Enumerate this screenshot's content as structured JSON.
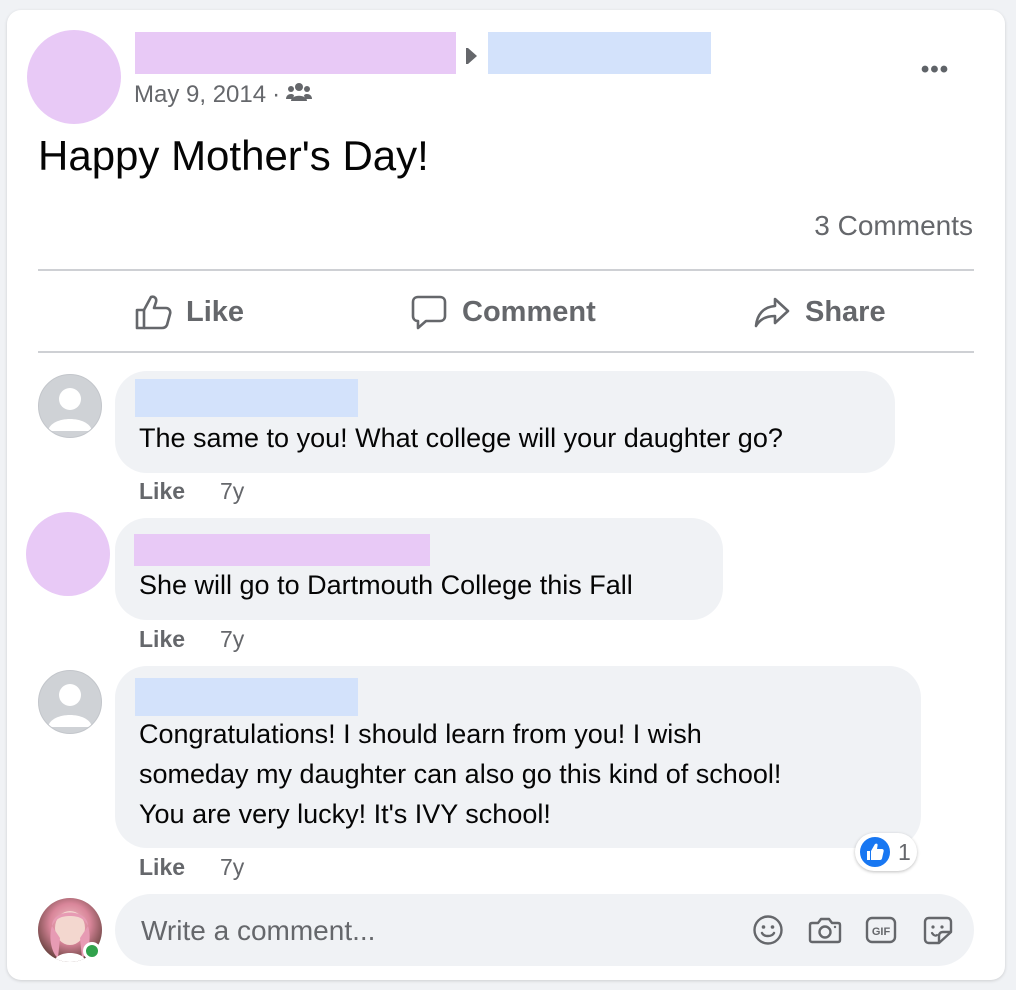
{
  "post": {
    "date": "May 9, 2014",
    "separator": "·",
    "audience_icon": "friends-icon",
    "more_icon": "more-options-icon",
    "more_label": "•••",
    "text": "Happy Mother's Day!",
    "comments_count": "3 Comments"
  },
  "actions": {
    "like": "Like",
    "comment": "Comment",
    "share": "Share"
  },
  "comments": [
    {
      "text": "The same to you! What college will your daughter go?",
      "like": "Like",
      "time": "7y"
    },
    {
      "text": "She will go to Dartmouth College this Fall",
      "like": "Like",
      "time": "7y"
    },
    {
      "lines": [
        "Congratulations! I should learn from you! I wish",
        "someday my daughter can also go this kind of school!",
        "You are very lucky! It's IVY school!"
      ],
      "like": "Like",
      "time": "7y",
      "reaction_count": "1"
    }
  ],
  "composer": {
    "placeholder": "Write a comment...",
    "tools": [
      "emoji-icon",
      "camera-icon",
      "gif-icon",
      "sticker-icon"
    ],
    "gif_label": "GIF"
  },
  "colors": {
    "redact_pink": "#e8c9f6",
    "redact_blue": "#d3e2fb",
    "secondary_text": "#65676b",
    "like_blue": "#1877f2",
    "online_green": "#31a24c"
  }
}
